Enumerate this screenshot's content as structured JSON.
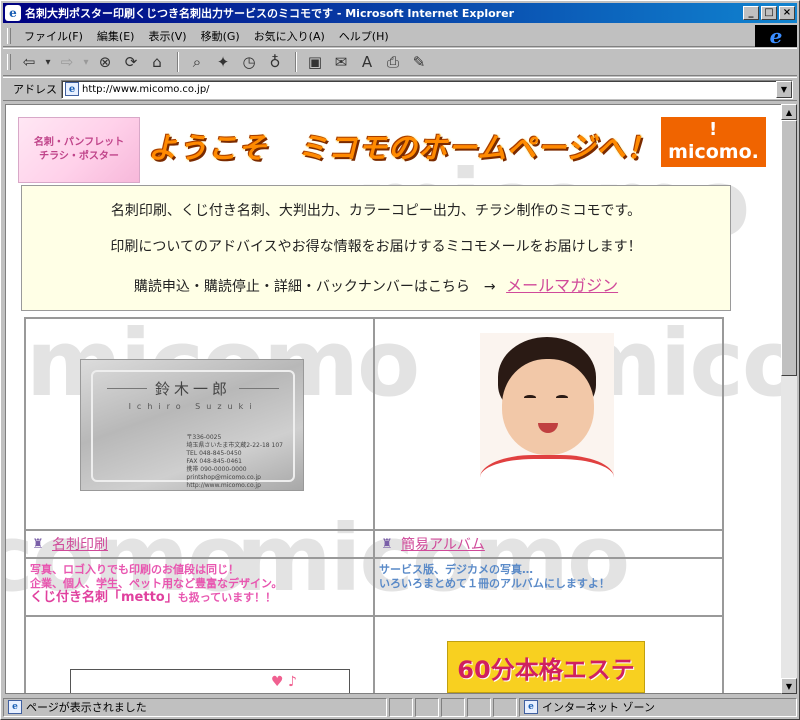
{
  "window": {
    "title": "名刺大判ポスター印刷くじつき名刺出力サービスのミコモです - Microsoft Internet Explorer",
    "icon": "ie-page-icon",
    "controls": [
      "_",
      "□",
      "×"
    ]
  },
  "menu": {
    "items": [
      "ファイル(F)",
      "編集(E)",
      "表示(V)",
      "移動(G)",
      "お気に入り(A)",
      "ヘルプ(H)"
    ],
    "logo": "e"
  },
  "toolbar": {
    "icons": [
      "back-icon",
      "forward-icon",
      "stop-icon",
      "refresh-icon",
      "home-icon",
      "search-icon",
      "favorites-icon",
      "history-icon",
      "channels-icon",
      "fullscreen-icon",
      "mail-icon",
      "font-icon",
      "print-icon",
      "edit-icon"
    ],
    "glyphs": [
      "⇦",
      "▾",
      "⇨",
      "▾",
      "⊗",
      "⟳",
      "⌂",
      "⌕",
      "✦",
      "◷",
      "♁",
      "▣",
      "✉",
      "A",
      "⎙",
      "✎"
    ]
  },
  "address": {
    "label": "アドレス",
    "url": "http://www.micomo.co.jp/"
  },
  "page": {
    "badge_line1": "名刺・パンフレット",
    "badge_line2": "チラシ・ポスター",
    "welcome": "ようこそ　ミコモのホームページへ！",
    "logo_text": "micomo.",
    "logo_bang": "!",
    "watermark": "micomo",
    "intro": {
      "line1": "名刺印刷、くじ付き名刺、大判出力、カラーコピー出力、チラシ制作のミコモです。",
      "line2": "印刷についてのアドバイスやお得な情報をお届けするミコモメールをお届けします！",
      "line3": "購読申込・購読停止・詳細・バックナンバーはこちら　→",
      "link": "メールマガジン"
    },
    "card": {
      "name": "鈴木一郎",
      "romaji": "Ichiro Suzuki",
      "addr1": "〒336-0025",
      "addr2": "埼玉県さいたま市文蔵2-22-18 107",
      "addr3": "TEL  048-845-0450",
      "addr4": "FAX  048-845-0461",
      "addr5": "携帯 090-0000-0000",
      "addr6": "printshop@micomo.co.jp",
      "addr7": "http://www.micomo.co.jp"
    },
    "sections": [
      {
        "title": "名刺印刷",
        "desc1": "写真、ロゴ入りでも印刷のお値段は同じ！",
        "desc2": "企業、個人、学生、ペット用など豊富なデザイン。",
        "desc3a": "くじ付き名刺「metto」",
        "desc3b": "も扱っています！！"
      },
      {
        "title": "簡易アルバム",
        "desc1": "サービス版、デジカメの写真…",
        "desc2": "いろいろまとめて１冊のアルバムにしますよ！"
      }
    ],
    "este": "60分本格エステ"
  },
  "status": {
    "text": "ページが表示されました",
    "zone": "インターネット ゾーン"
  }
}
